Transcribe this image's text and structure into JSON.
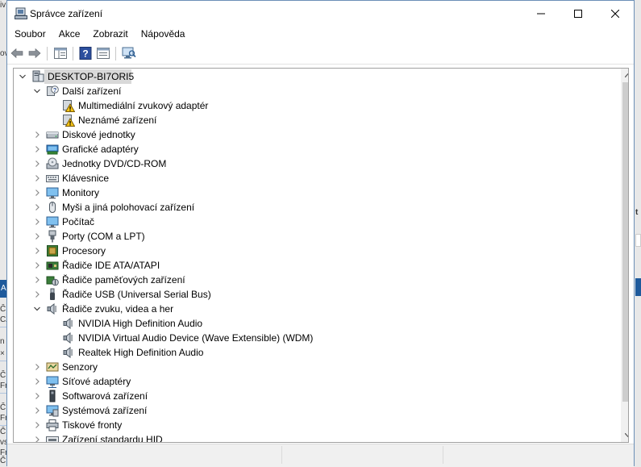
{
  "window": {
    "title": "Správce zařízení"
  },
  "menu": [
    "Soubor",
    "Akce",
    "Zobrazit",
    "Nápověda"
  ],
  "background_fragments": [
    "iv",
    "ov",
    "A",
    "Čí",
    "CZ",
    "n",
    "×",
    "Čí",
    "Fr",
    "Čí",
    "Fr",
    "Čí",
    "vs",
    "Fr",
    "Čí",
    "t"
  ],
  "tree": [
    {
      "label": "DESKTOP-BI7ORI5",
      "level": 0,
      "expander": "expanded",
      "icon": "computer-icon",
      "selected": true
    },
    {
      "label": "Další zařízení",
      "level": 1,
      "expander": "expanded",
      "icon": "unknown-device-icon"
    },
    {
      "label": "Multimediální zvukový adaptér",
      "level": 2,
      "expander": "none",
      "icon": "warning-device-icon"
    },
    {
      "label": "Neznámé zařízení",
      "level": 2,
      "expander": "none",
      "icon": "warning-device-icon"
    },
    {
      "label": "Diskové jednotky",
      "level": 1,
      "expander": "collapsed",
      "icon": "disk-drive-icon"
    },
    {
      "label": "Grafické adaptéry",
      "level": 1,
      "expander": "collapsed",
      "icon": "display-adapter-icon"
    },
    {
      "label": "Jednotky DVD/CD-ROM",
      "level": 1,
      "expander": "collapsed",
      "icon": "dvd-drive-icon"
    },
    {
      "label": "Klávesnice",
      "level": 1,
      "expander": "collapsed",
      "icon": "keyboard-icon"
    },
    {
      "label": "Monitory",
      "level": 1,
      "expander": "collapsed",
      "icon": "monitor-icon"
    },
    {
      "label": "Myši a jiná polohovací zařízení",
      "level": 1,
      "expander": "collapsed",
      "icon": "mouse-icon"
    },
    {
      "label": "Počítač",
      "level": 1,
      "expander": "collapsed",
      "icon": "pc-icon"
    },
    {
      "label": "Porty (COM a LPT)",
      "level": 1,
      "expander": "collapsed",
      "icon": "port-icon"
    },
    {
      "label": "Procesory",
      "level": 1,
      "expander": "collapsed",
      "icon": "processor-icon"
    },
    {
      "label": "Řadiče IDE ATA/ATAPI",
      "level": 1,
      "expander": "collapsed",
      "icon": "ide-controller-icon"
    },
    {
      "label": "Řadiče paměťových zařízení",
      "level": 1,
      "expander": "collapsed",
      "icon": "storage-controller-icon"
    },
    {
      "label": "Řadiče USB (Universal Serial Bus)",
      "level": 1,
      "expander": "collapsed",
      "icon": "usb-icon"
    },
    {
      "label": "Řadiče zvuku, videa a her",
      "level": 1,
      "expander": "expanded",
      "icon": "speaker-icon"
    },
    {
      "label": "NVIDIA High Definition Audio",
      "level": 2,
      "expander": "none",
      "icon": "speaker-icon"
    },
    {
      "label": "NVIDIA Virtual Audio Device (Wave Extensible) (WDM)",
      "level": 2,
      "expander": "none",
      "icon": "speaker-icon"
    },
    {
      "label": "Realtek High Definition Audio",
      "level": 2,
      "expander": "none",
      "icon": "speaker-icon"
    },
    {
      "label": "Senzory",
      "level": 1,
      "expander": "collapsed",
      "icon": "sensor-icon"
    },
    {
      "label": "Síťové adaptéry",
      "level": 1,
      "expander": "collapsed",
      "icon": "network-adapter-icon"
    },
    {
      "label": "Softwarová zařízení",
      "level": 1,
      "expander": "collapsed",
      "icon": "software-device-icon"
    },
    {
      "label": "Systémová zařízení",
      "level": 1,
      "expander": "collapsed",
      "icon": "system-device-icon"
    },
    {
      "label": "Tiskové fronty",
      "level": 1,
      "expander": "collapsed",
      "icon": "printer-icon"
    },
    {
      "label": "Zařízení standardu HID",
      "level": 1,
      "expander": "collapsed",
      "icon": "hid-icon"
    }
  ],
  "colors": {
    "selection": "#d9d9d9",
    "border": "#6b8fb7",
    "warning": "#f5c518",
    "scroll_thumb": "#cdcdcd"
  }
}
